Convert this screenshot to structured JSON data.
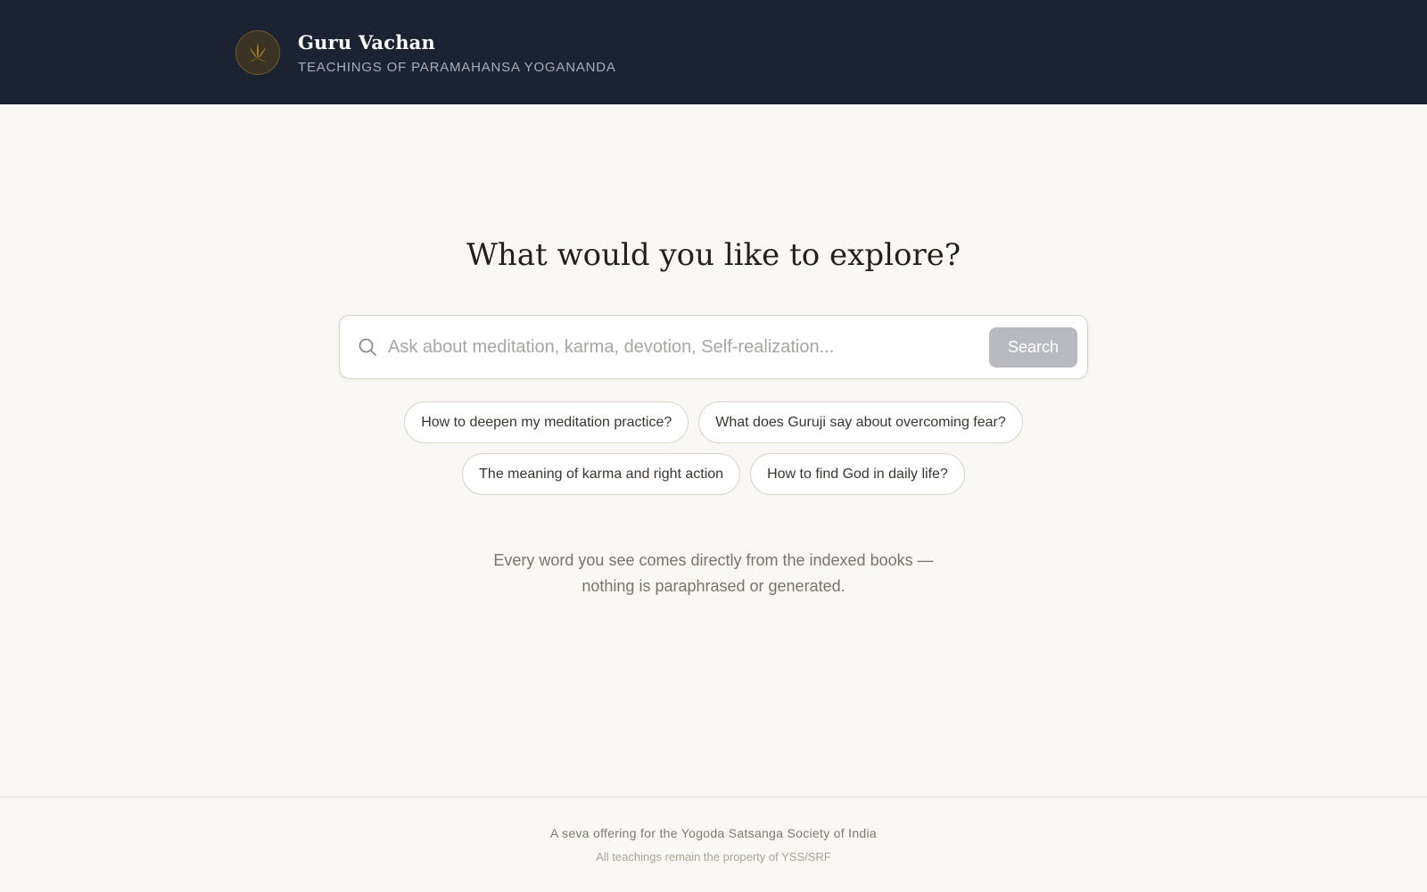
{
  "header": {
    "logo_icon": "lotus-icon",
    "title": "Guru Vachan",
    "subtitle": "TEACHINGS OF PARAMAHANSA YOGANANDA",
    "background_color": "#1b2333",
    "accent_color": "#d4a028"
  },
  "main": {
    "heading": "What would you like to explore?",
    "search": {
      "icon": "search-icon",
      "placeholder": "Ask about meditation, karma, devotion, Self-realization...",
      "value": "",
      "button_label": "Search"
    },
    "suggestions": [
      "How to deepen my meditation practice?",
      "What does Guruji say about overcoming fear?",
      "The meaning of karma and right action",
      "How to find God in daily life?"
    ],
    "note_line1": "Every word you see comes directly from the indexed books —",
    "note_line2": "nothing is paraphrased or generated."
  },
  "footer": {
    "line1": "A seva offering for the Yogoda Satsanga Society of India",
    "line2": "All teachings remain the property of YSS/SRF"
  }
}
